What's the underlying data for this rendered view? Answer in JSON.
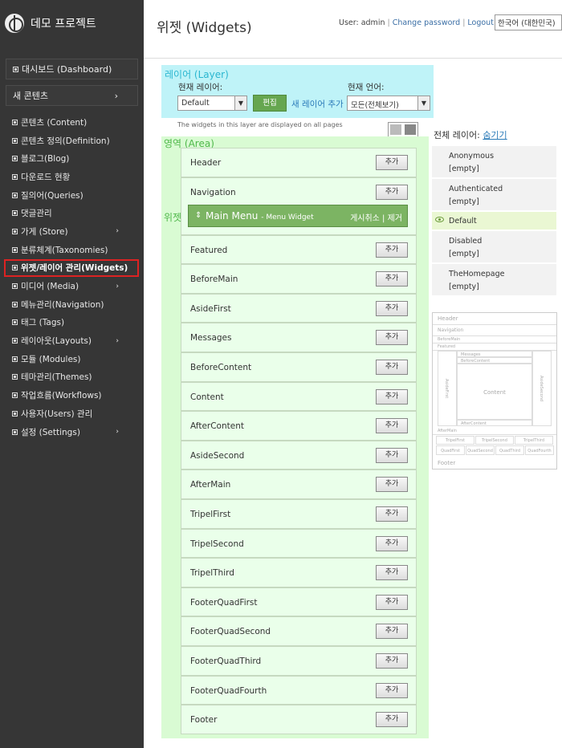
{
  "app": {
    "title": "데모 프로젝트",
    "page_title": "위젯 (Widgets)"
  },
  "user": {
    "text": "User: admin",
    "change_password": "Change password",
    "logout": "Logout",
    "language": "한국어 (대한민국)"
  },
  "sidebar": {
    "dashboard": "대시보드 (Dashboard)",
    "new_content": "새 콘텐츠",
    "items": [
      {
        "label": "콘텐츠 (Content)",
        "arrow": false
      },
      {
        "label": "콘텐츠 정의(Definition)",
        "arrow": false
      },
      {
        "label": "블로그(Blog)",
        "arrow": false
      },
      {
        "label": "다운로드 현황",
        "arrow": false
      },
      {
        "label": "질의어(Queries)",
        "arrow": false
      },
      {
        "label": "댓글관리",
        "arrow": false
      },
      {
        "label": "가게 (Store)",
        "arrow": true
      },
      {
        "label": "분류체계(Taxonomies)",
        "arrow": false
      },
      {
        "label": "위젯/레이어 관리(Widgets)",
        "arrow": false,
        "active": true
      },
      {
        "label": "미디어 (Media)",
        "arrow": true
      },
      {
        "label": "메뉴관리(Navigation)",
        "arrow": false
      },
      {
        "label": "태그 (Tags)",
        "arrow": false
      },
      {
        "label": "레이아웃(Layouts)",
        "arrow": true
      },
      {
        "label": "모듈 (Modules)",
        "arrow": false
      },
      {
        "label": "테마관리(Themes)",
        "arrow": false
      },
      {
        "label": "작업흐름(Workflows)",
        "arrow": false
      },
      {
        "label": "사용자(Users) 관리",
        "arrow": false
      },
      {
        "label": "설정 (Settings)",
        "arrow": true
      }
    ]
  },
  "layer_panel": {
    "label": "레이어 (Layer)",
    "current_layer_label": "현재 레이어:",
    "current_layer_value": "Default",
    "edit_button": "편집",
    "add_layer": "새 레이어 추가",
    "current_lang_label": "현재 언어:",
    "current_lang_value": "모든(전체보기)"
  },
  "info_line": "The widgets in this layer are displayed on all pages",
  "area_label": "영역 (Area)",
  "widget_label": "위젯",
  "add_label": "추가",
  "zones": [
    "Header",
    "Navigation",
    "Featured",
    "BeforeMain",
    "AsideFirst",
    "Messages",
    "BeforeContent",
    "Content",
    "AfterContent",
    "AsideSecond",
    "AfterMain",
    "TripelFirst",
    "TripelSecond",
    "TripelThird",
    "FooterQuadFirst",
    "FooterQuadSecond",
    "FooterQuadThird",
    "FooterQuadFourth",
    "Footer"
  ],
  "widget": {
    "name": "Main Menu",
    "type": "- Menu Widget",
    "actions": "게시취소 | 제거"
  },
  "all_layers": {
    "title": "전체 레이어:",
    "hide": "숨기기",
    "layers": [
      {
        "name": "Anonymous",
        "state": "[empty]"
      },
      {
        "name": "Authenticated",
        "state": "[empty]"
      },
      {
        "name": "Default",
        "state": "",
        "active": true
      },
      {
        "name": "Disabled",
        "state": "[empty]"
      },
      {
        "name": "TheHomepage",
        "state": "[empty]"
      }
    ]
  },
  "minimap": {
    "header": "Header",
    "navigation": "Navigation",
    "beforemain": "BeforeMain",
    "featured": "Featured",
    "messages": "Messages",
    "beforecontent": "BeforeContent",
    "content": "Content",
    "aftercontent": "AfterContent",
    "asidefirst": "AsideFirst",
    "asidesecond": "AsideSecond",
    "aftermain": "AfterMain",
    "tripelfirst": "TripelFirst",
    "tripelsecond": "TripelSecond",
    "tripelthird": "TripelThird",
    "quadfirst": "QuadFirst",
    "quadsecond": "QuadSecond",
    "quadthird": "QuadThird",
    "quadfourth": "QuadFourth",
    "footer": "Footer"
  }
}
